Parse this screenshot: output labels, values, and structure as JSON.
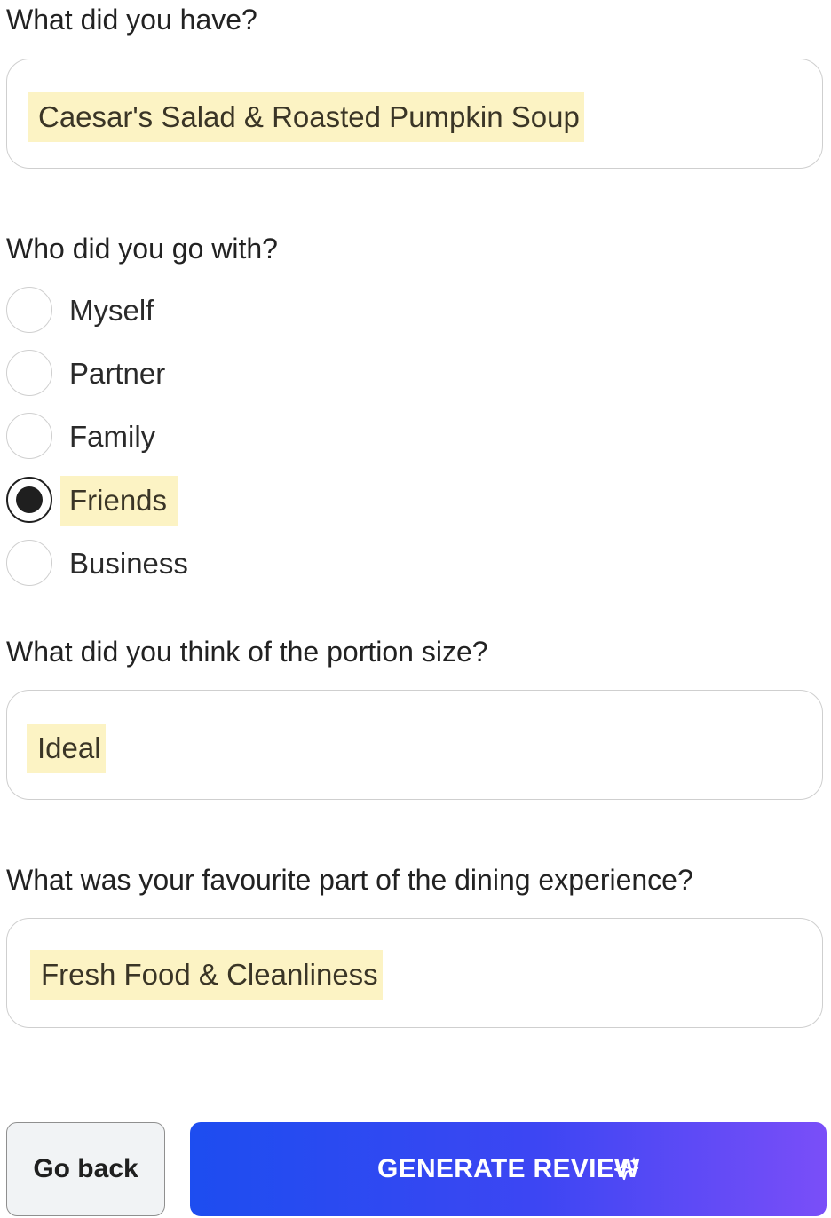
{
  "questions": {
    "had": {
      "label": "What did you have?",
      "value": "Caesar's Salad & Roasted Pumpkin Soup"
    },
    "company": {
      "label": "Who did you go with?",
      "options": [
        {
          "label": "Myself",
          "selected": false
        },
        {
          "label": "Partner",
          "selected": false
        },
        {
          "label": "Family",
          "selected": false
        },
        {
          "label": "Friends",
          "selected": true
        },
        {
          "label": "Business",
          "selected": false
        }
      ]
    },
    "portion": {
      "label": "What did you think of the portion size?",
      "value": "Ideal"
    },
    "favourite": {
      "label": "What was your favourite part of the dining experience?",
      "value": "Fresh Food & Cleanliness"
    }
  },
  "actions": {
    "back_label": "Go back",
    "generate_label": "GENERATE REVIEW",
    "generate_icon": "sparkle-icon"
  },
  "colors": {
    "highlight": "#fcf3c4",
    "button_gradient_start": "#1d4df0",
    "button_gradient_end": "#7a4ef8"
  }
}
